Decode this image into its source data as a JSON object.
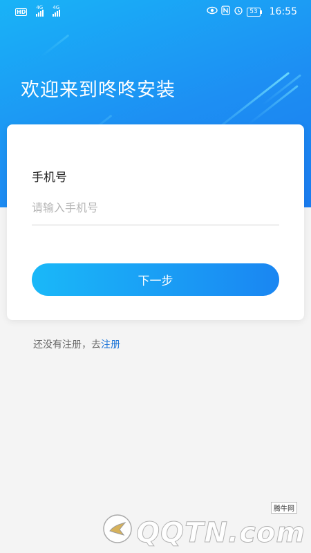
{
  "status_bar": {
    "hd": "HD",
    "network1": "4G",
    "network2": "4G",
    "battery": "53",
    "time": "16:55"
  },
  "welcome_title": "欢迎来到咚咚安装",
  "form": {
    "phone_label": "手机号",
    "phone_placeholder": "请输入手机号",
    "phone_value": "",
    "next_button": "下一步"
  },
  "register": {
    "prompt": "还没有注册，去",
    "link": "注册"
  },
  "watermark": {
    "tag": "腾牛网",
    "text": "QQTN.com"
  },
  "colors": {
    "hero_gradient_start": "#19b3f7",
    "hero_gradient_end": "#1a7cf0",
    "accent_link": "#1a74d8",
    "page_background": "#f4f4f4"
  },
  "icons": [
    "hd-icon",
    "signal-icon",
    "eye-comfort-icon",
    "nfc-icon",
    "alarm-icon",
    "battery-icon"
  ]
}
